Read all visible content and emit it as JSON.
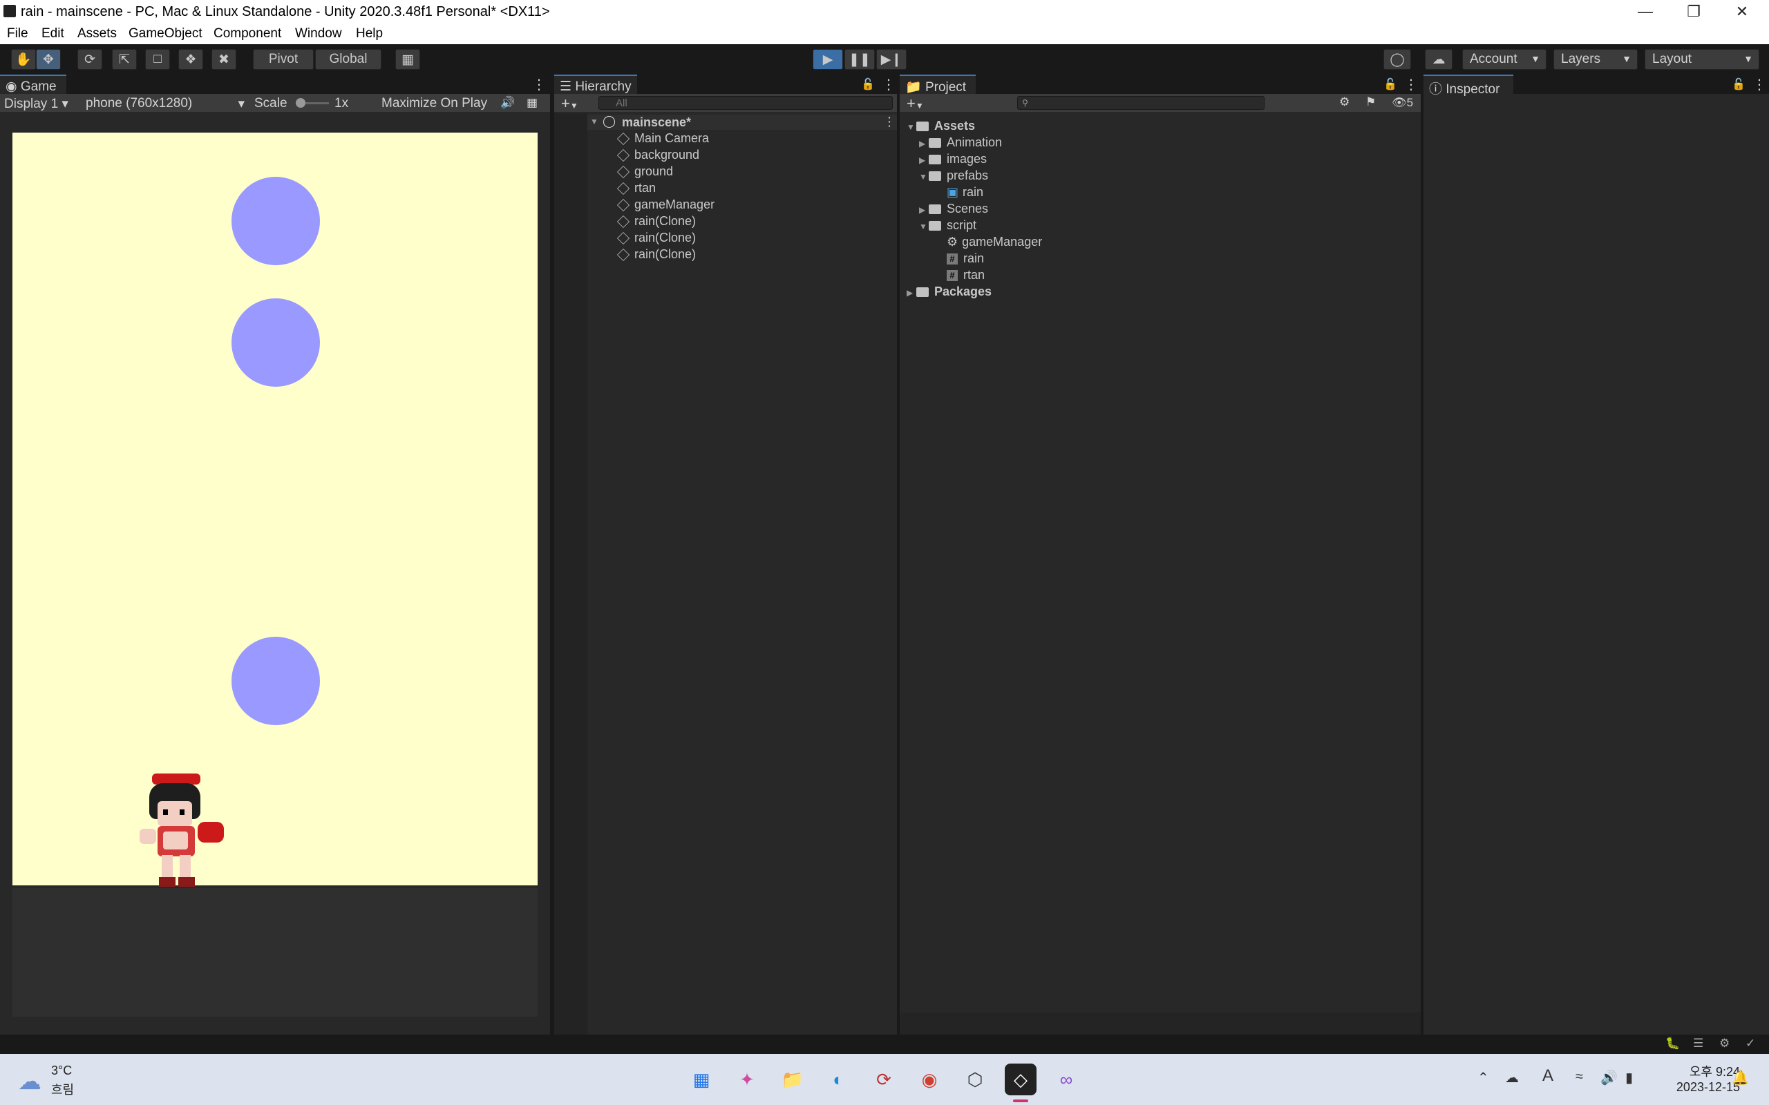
{
  "window": {
    "title": "rain - mainscene - PC, Mac & Linux Standalone - Unity 2020.3.48f1 Personal* <DX11>"
  },
  "menu": [
    "File",
    "Edit",
    "Assets",
    "GameObject",
    "Component",
    "Window",
    "Help"
  ],
  "toolbar": {
    "pivot": "Pivot",
    "global": "Global",
    "account": "Account",
    "layers": "Layers",
    "layout": "Layout"
  },
  "game": {
    "tab": "Game",
    "display": "Display 1",
    "resolution": "phone (760x1280)",
    "scale_label": "Scale",
    "scale_value": "1x",
    "maximize": "Maximize On Play",
    "bg": "#ffffcc",
    "drop_color": "#9999ff"
  },
  "hierarchy": {
    "tab": "Hierarchy",
    "search_placeholder": "All",
    "scene": "mainscene*",
    "items": [
      "Main Camera",
      "background",
      "ground",
      "rtan",
      "gameManager",
      "rain(Clone)",
      "rain(Clone)",
      "rain(Clone)"
    ]
  },
  "project": {
    "tab": "Project",
    "hidden_count": "5",
    "assets": "Assets",
    "animation": "Animation",
    "images": "images",
    "prefabs": "prefabs",
    "rain_prefab": "rain",
    "scenes": "Scenes",
    "script": "script",
    "gamemanager": "gameManager",
    "rain_script": "rain",
    "rtan_script": "rtan",
    "packages": "Packages"
  },
  "inspector": {
    "tab": "Inspector"
  },
  "taskbar": {
    "temp": "3°C",
    "weather": "흐림",
    "time": "오후 9:24",
    "date": "2023-12-15"
  }
}
